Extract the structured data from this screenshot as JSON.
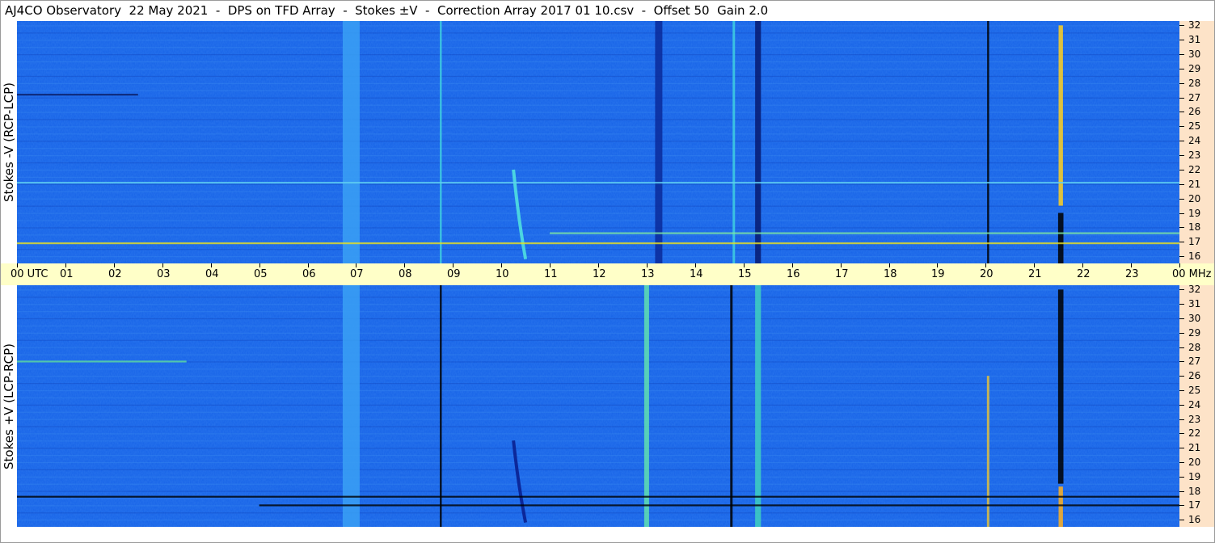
{
  "title": "AJ4CO Observatory  22 May 2021  -  DPS on TFD Array  -  Stokes ±V  -  Correction Array 2017 01 10.csv  -  Offset 50  Gain 2.0",
  "panels": {
    "top_label": "Stokes -V (RCP-LCP)",
    "bottom_label": "Stokes +V (LCP-RCP)"
  },
  "colors": {
    "background_blue": "#1a66e8",
    "time_axis_bg": "#ffffc8",
    "freq_axis_bg": "#fde3c8"
  },
  "chart_data": {
    "type": "heatmap",
    "title": "AJ4CO Observatory  22 May 2021  -  DPS on TFD Array  -  Stokes ±V  -  Correction Array 2017 01 10.csv  -  Offset 50  Gain 2.0",
    "xlabel": "UTC",
    "ylabel": "MHz",
    "xlim": [
      0,
      24
    ],
    "ylim": [
      15.5,
      32.3
    ],
    "x_ticks": [
      "00",
      "01",
      "02",
      "03",
      "04",
      "05",
      "06",
      "07",
      "08",
      "09",
      "10",
      "11",
      "12",
      "13",
      "14",
      "15",
      "16",
      "17",
      "18",
      "19",
      "20",
      "21",
      "22",
      "23",
      "00"
    ],
    "x_ticks_display": [
      "00  UTC",
      "01",
      "02",
      "03",
      "04",
      "05",
      "06",
      "07",
      "08",
      "09",
      "10",
      "11",
      "12",
      "13",
      "14",
      "15",
      "16",
      "17",
      "18",
      "19",
      "20",
      "21",
      "22",
      "23",
      "00 MHz"
    ],
    "y_ticks": [
      "16",
      "17",
      "18",
      "19",
      "20",
      "21",
      "22",
      "23",
      "24",
      "25",
      "26",
      "27",
      "28",
      "29",
      "30",
      "31",
      "32"
    ],
    "colorscale": "jet",
    "panels": [
      {
        "name": "Stokes -V (RCP-LCP)",
        "features": [
          {
            "kind": "vertical",
            "t": 6.9,
            "width": 0.35,
            "color": "#3aa0f5"
          },
          {
            "kind": "vertical",
            "t": 8.75,
            "width": 0.04,
            "color": "#40d0e0"
          },
          {
            "kind": "vertical",
            "t": 13.25,
            "width": 0.15,
            "color": "#0a2a9a"
          },
          {
            "kind": "vertical",
            "t": 14.8,
            "width": 0.05,
            "color": "#40d0e0"
          },
          {
            "kind": "vertical",
            "t": 15.3,
            "width": 0.12,
            "color": "#071a70"
          },
          {
            "kind": "vertical",
            "t": 20.05,
            "width": 0.04,
            "color": "#000000"
          },
          {
            "kind": "vertical",
            "t": 21.55,
            "width": 0.09,
            "color": "#ffd020",
            "f_min": 19.5,
            "f_max": 32
          },
          {
            "kind": "vertical",
            "t": 21.55,
            "width": 0.11,
            "color": "#000000",
            "f_min": 15.5,
            "f_max": 19.0
          },
          {
            "kind": "burst",
            "t_start": 10.25,
            "t_end": 10.5,
            "f_high": 22.0,
            "f_low": 15.8,
            "color": "#50e0e0"
          },
          {
            "kind": "horizontal",
            "f": 16.9,
            "t_start": 0,
            "t_end": 24,
            "color": "#e8e020"
          },
          {
            "kind": "horizontal",
            "f": 17.6,
            "t_start": 11,
            "t_end": 24,
            "color": "#80e8a0"
          },
          {
            "kind": "horizontal",
            "f": 27.2,
            "t_start": 0,
            "t_end": 2.5,
            "color": "#0a1a60"
          },
          {
            "kind": "horizontal",
            "f": 21.1,
            "t_start": 0,
            "t_end": 24,
            "color": "#60d0f0"
          }
        ]
      },
      {
        "name": "Stokes +V (LCP-RCP)",
        "features": [
          {
            "kind": "vertical",
            "t": 6.9,
            "width": 0.35,
            "color": "#3aa0f5"
          },
          {
            "kind": "vertical",
            "t": 8.75,
            "width": 0.04,
            "color": "#000000"
          },
          {
            "kind": "vertical",
            "t": 13.0,
            "width": 0.1,
            "color": "#60e0b0"
          },
          {
            "kind": "vertical",
            "t": 14.75,
            "width": 0.05,
            "color": "#000000"
          },
          {
            "kind": "vertical",
            "t": 15.3,
            "width": 0.12,
            "color": "#40d0c0"
          },
          {
            "kind": "vertical",
            "t": 20.05,
            "width": 0.05,
            "color": "#e0c040",
            "f_min": 15.5,
            "f_max": 26
          },
          {
            "kind": "vertical",
            "t": 21.55,
            "width": 0.11,
            "color": "#000000",
            "f_min": 18.5,
            "f_max": 32
          },
          {
            "kind": "vertical",
            "t": 21.55,
            "width": 0.09,
            "color": "#ffb020",
            "f_min": 15.5,
            "f_max": 18.3
          },
          {
            "kind": "burst",
            "t_start": 10.25,
            "t_end": 10.5,
            "f_high": 21.5,
            "f_low": 15.8,
            "color": "#0a2090"
          },
          {
            "kind": "horizontal",
            "f": 17.6,
            "t_start": 0,
            "t_end": 24,
            "color": "#000000"
          },
          {
            "kind": "horizontal",
            "f": 17.0,
            "t_start": 5,
            "t_end": 24,
            "color": "#000000"
          },
          {
            "kind": "horizontal",
            "f": 27.0,
            "t_start": 0,
            "t_end": 3.5,
            "color": "#60e0a0"
          }
        ]
      }
    ]
  }
}
